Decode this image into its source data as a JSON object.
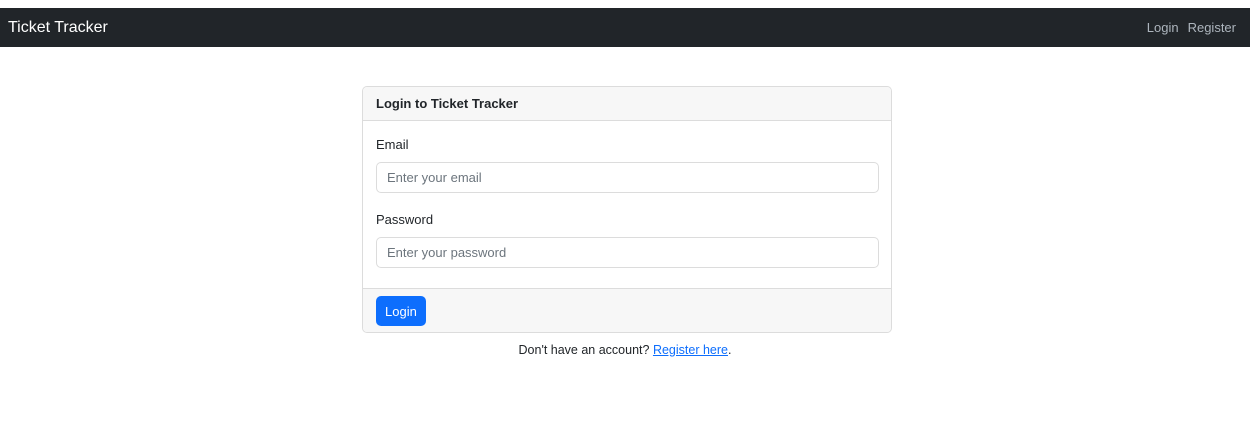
{
  "navbar": {
    "brand": "Ticket Tracker",
    "links": {
      "login": "Login",
      "register": "Register"
    }
  },
  "login_card": {
    "title": "Login to Ticket Tracker",
    "email": {
      "label": "Email",
      "value": "",
      "placeholder": "Enter your email"
    },
    "password": {
      "label": "Password",
      "value": "",
      "placeholder": "Enter your password"
    },
    "submit_label": "Login"
  },
  "register_prompt": {
    "text": "Don't have an account?",
    "link_text": "Register here",
    "suffix": "."
  },
  "colors": {
    "navbar_bg": "#212529",
    "primary": "#0d6efd",
    "card_header_bg": "#f7f7f7",
    "border": "#dcdcdc"
  }
}
